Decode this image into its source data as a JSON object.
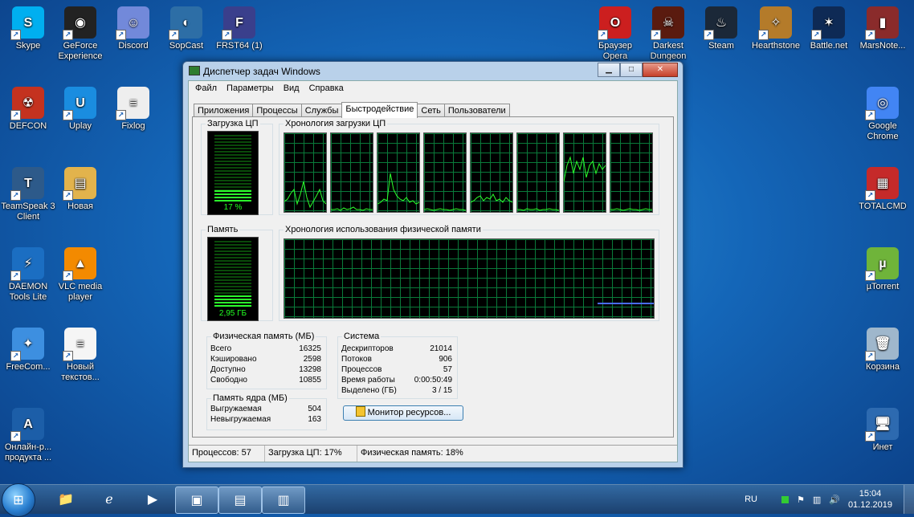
{
  "desktop": {
    "left_icons": [
      {
        "label": "Skype",
        "color": "#00aff0",
        "glyph": "S"
      },
      {
        "label": "GeForce Experience",
        "color": "#222",
        "glyph": "◉"
      },
      {
        "label": "Discord",
        "color": "#7289da",
        "glyph": "☺"
      },
      {
        "label": "SopCast",
        "color": "#2d6ea6",
        "glyph": "◐"
      },
      {
        "label": "FRST64 (1)",
        "color": "#3a3f8c",
        "glyph": "F"
      },
      {
        "label": "DEFCON",
        "color": "#c4321f",
        "glyph": "☢"
      },
      {
        "label": "Uplay",
        "color": "#1a8de0",
        "glyph": "U"
      },
      {
        "label": "Fixlog",
        "color": "#eeeeee",
        "glyph": "≡"
      },
      {
        "label": "TeamSpeak 3 Client",
        "color": "#2d5a8a",
        "glyph": "T"
      },
      {
        "label": "Новая",
        "color": "#e2b34c",
        "glyph": "▤"
      },
      {
        "label": "DAEMON Tools Lite",
        "color": "#1b6ec2",
        "glyph": "⚡"
      },
      {
        "label": "VLC media player",
        "color": "#f38a00",
        "glyph": "▲"
      },
      {
        "label": "FreeCom...",
        "color": "#3d8fe0",
        "glyph": "✦"
      },
      {
        "label": "Новый текстов...",
        "color": "#f5f5f5",
        "glyph": "≡"
      },
      {
        "label": "Онлайн-р... продукта ...",
        "color": "#1c5ea8",
        "glyph": "A"
      }
    ],
    "right_icons": [
      {
        "label": "Браузер Opera",
        "color": "#cc1f1f",
        "glyph": "O"
      },
      {
        "label": "Darkest Dungeon",
        "color": "#5a1b0f",
        "glyph": "☠"
      },
      {
        "label": "Steam",
        "color": "#1b2838",
        "glyph": "♨"
      },
      {
        "label": "Hearthstone",
        "color": "#b47b2a",
        "glyph": "✧"
      },
      {
        "label": "Battle.net",
        "color": "#0e2a55",
        "glyph": "✶"
      },
      {
        "label": "MarsNote...",
        "color": "#8a2b2b",
        "glyph": "▮"
      },
      {
        "label": "Google Chrome",
        "color": "#4285f4",
        "glyph": "◎"
      },
      {
        "label": "TOTALCMD",
        "color": "#c52a2a",
        "glyph": "▦"
      },
      {
        "label": "µTorrent",
        "color": "#6fb43a",
        "glyph": "µ"
      },
      {
        "label": "Корзина",
        "color": "#9fb7cc",
        "glyph": "🗑"
      },
      {
        "label": "Инет",
        "color": "#2d6ab0",
        "glyph": "🖥"
      }
    ]
  },
  "window": {
    "title": "Диспетчер задач Windows",
    "menu": [
      "Файл",
      "Параметры",
      "Вид",
      "Справка"
    ],
    "tabs": [
      "Приложения",
      "Процессы",
      "Службы",
      "Быстродействие",
      "Сеть",
      "Пользователи"
    ],
    "active_tab": "Быстродействие",
    "cpu_usage_label": "Загрузка ЦП",
    "cpu_value": "17 %",
    "cpu_fraction": 0.17,
    "cpu_history_label": "Хронология загрузки ЦП",
    "mem_label": "Память",
    "mem_value": "2,95 ГБ",
    "mem_fraction": 0.18,
    "mem_history_label": "Хронология использования физической памяти",
    "physical": {
      "title": "Физическая память (МБ)",
      "rows": [
        [
          "Всего",
          "16325"
        ],
        [
          "Кэшировано",
          "2598"
        ],
        [
          "Доступно",
          "13298"
        ],
        [
          "Свободно",
          "10855"
        ]
      ]
    },
    "kernel": {
      "title": "Память ядра (МБ)",
      "rows": [
        [
          "Выгружаемая",
          "504"
        ],
        [
          "Невыгружаемая",
          "163"
        ]
      ]
    },
    "system": {
      "title": "Система",
      "rows": [
        [
          "Дескрипторов",
          "21014"
        ],
        [
          "Потоков",
          "906"
        ],
        [
          "Процессов",
          "57"
        ],
        [
          "Время работы",
          "0:00:50:49"
        ],
        [
          "Выделено (ГБ)",
          "3 / 15"
        ]
      ]
    },
    "resource_monitor_button": "Монитор ресурсов...",
    "status": [
      "Процессов: 57",
      "Загрузка ЦП: 17%",
      "Физическая память: 18%"
    ]
  },
  "taskbar": {
    "lang": "RU",
    "time": "15:04",
    "date": "01.12.2019"
  }
}
